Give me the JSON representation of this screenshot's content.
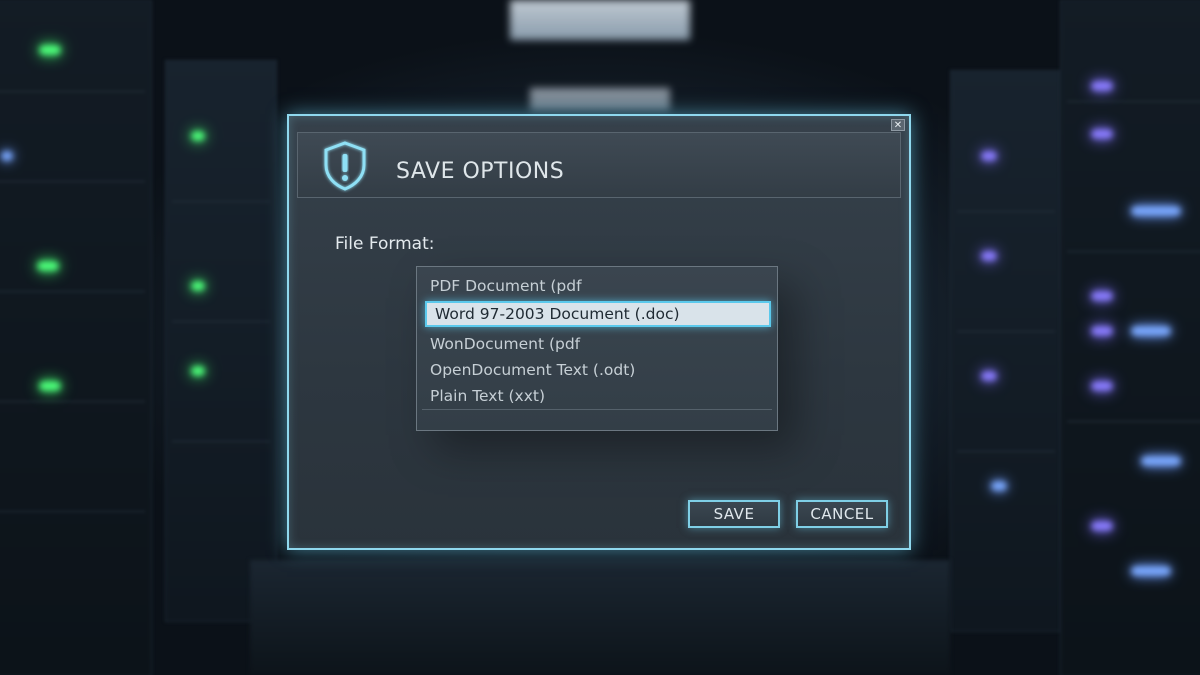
{
  "dialog": {
    "title": "SAVE OPTIONS",
    "close_glyph": "✕",
    "title_icon": "shield-alert-icon"
  },
  "file_format": {
    "label": "File Format:",
    "options": [
      "PDF Document (pdf",
      "Word 97-2003 Document (.doc)",
      "WonDocument (pdf",
      "OpenDocument Text (.odt)",
      "Plain Text (xxt)"
    ],
    "selected_index": 1
  },
  "buttons": {
    "save_label": "SAVE",
    "cancel_label": "CANCEL"
  },
  "colors": {
    "accent_glow": "#8fd8ee",
    "selection_border": "#5bc9ec",
    "selection_fill": "#d9e3ea"
  }
}
